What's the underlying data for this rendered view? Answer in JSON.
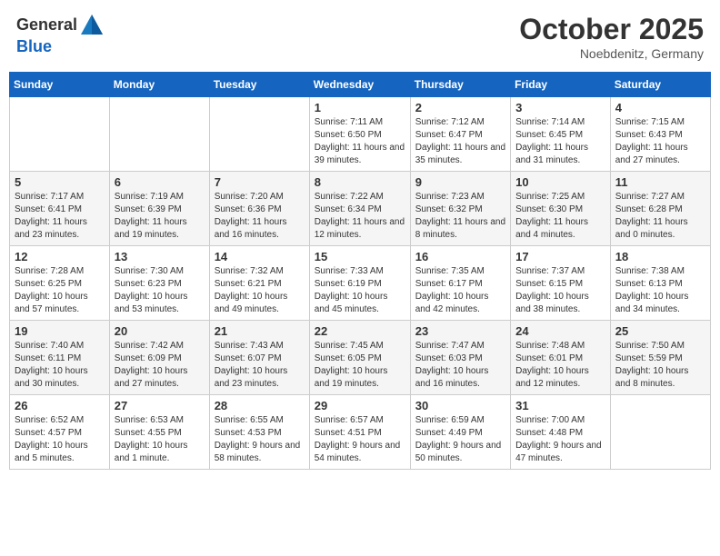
{
  "header": {
    "logo_line1": "General",
    "logo_line2": "Blue",
    "month": "October 2025",
    "location": "Noebdenitz, Germany"
  },
  "weekdays": [
    "Sunday",
    "Monday",
    "Tuesday",
    "Wednesday",
    "Thursday",
    "Friday",
    "Saturday"
  ],
  "weeks": [
    [
      {
        "day": "",
        "info": ""
      },
      {
        "day": "",
        "info": ""
      },
      {
        "day": "",
        "info": ""
      },
      {
        "day": "1",
        "info": "Sunrise: 7:11 AM\nSunset: 6:50 PM\nDaylight: 11 hours and 39 minutes."
      },
      {
        "day": "2",
        "info": "Sunrise: 7:12 AM\nSunset: 6:47 PM\nDaylight: 11 hours and 35 minutes."
      },
      {
        "day": "3",
        "info": "Sunrise: 7:14 AM\nSunset: 6:45 PM\nDaylight: 11 hours and 31 minutes."
      },
      {
        "day": "4",
        "info": "Sunrise: 7:15 AM\nSunset: 6:43 PM\nDaylight: 11 hours and 27 minutes."
      }
    ],
    [
      {
        "day": "5",
        "info": "Sunrise: 7:17 AM\nSunset: 6:41 PM\nDaylight: 11 hours and 23 minutes."
      },
      {
        "day": "6",
        "info": "Sunrise: 7:19 AM\nSunset: 6:39 PM\nDaylight: 11 hours and 19 minutes."
      },
      {
        "day": "7",
        "info": "Sunrise: 7:20 AM\nSunset: 6:36 PM\nDaylight: 11 hours and 16 minutes."
      },
      {
        "day": "8",
        "info": "Sunrise: 7:22 AM\nSunset: 6:34 PM\nDaylight: 11 hours and 12 minutes."
      },
      {
        "day": "9",
        "info": "Sunrise: 7:23 AM\nSunset: 6:32 PM\nDaylight: 11 hours and 8 minutes."
      },
      {
        "day": "10",
        "info": "Sunrise: 7:25 AM\nSunset: 6:30 PM\nDaylight: 11 hours and 4 minutes."
      },
      {
        "day": "11",
        "info": "Sunrise: 7:27 AM\nSunset: 6:28 PM\nDaylight: 11 hours and 0 minutes."
      }
    ],
    [
      {
        "day": "12",
        "info": "Sunrise: 7:28 AM\nSunset: 6:25 PM\nDaylight: 10 hours and 57 minutes."
      },
      {
        "day": "13",
        "info": "Sunrise: 7:30 AM\nSunset: 6:23 PM\nDaylight: 10 hours and 53 minutes."
      },
      {
        "day": "14",
        "info": "Sunrise: 7:32 AM\nSunset: 6:21 PM\nDaylight: 10 hours and 49 minutes."
      },
      {
        "day": "15",
        "info": "Sunrise: 7:33 AM\nSunset: 6:19 PM\nDaylight: 10 hours and 45 minutes."
      },
      {
        "day": "16",
        "info": "Sunrise: 7:35 AM\nSunset: 6:17 PM\nDaylight: 10 hours and 42 minutes."
      },
      {
        "day": "17",
        "info": "Sunrise: 7:37 AM\nSunset: 6:15 PM\nDaylight: 10 hours and 38 minutes."
      },
      {
        "day": "18",
        "info": "Sunrise: 7:38 AM\nSunset: 6:13 PM\nDaylight: 10 hours and 34 minutes."
      }
    ],
    [
      {
        "day": "19",
        "info": "Sunrise: 7:40 AM\nSunset: 6:11 PM\nDaylight: 10 hours and 30 minutes."
      },
      {
        "day": "20",
        "info": "Sunrise: 7:42 AM\nSunset: 6:09 PM\nDaylight: 10 hours and 27 minutes."
      },
      {
        "day": "21",
        "info": "Sunrise: 7:43 AM\nSunset: 6:07 PM\nDaylight: 10 hours and 23 minutes."
      },
      {
        "day": "22",
        "info": "Sunrise: 7:45 AM\nSunset: 6:05 PM\nDaylight: 10 hours and 19 minutes."
      },
      {
        "day": "23",
        "info": "Sunrise: 7:47 AM\nSunset: 6:03 PM\nDaylight: 10 hours and 16 minutes."
      },
      {
        "day": "24",
        "info": "Sunrise: 7:48 AM\nSunset: 6:01 PM\nDaylight: 10 hours and 12 minutes."
      },
      {
        "day": "25",
        "info": "Sunrise: 7:50 AM\nSunset: 5:59 PM\nDaylight: 10 hours and 8 minutes."
      }
    ],
    [
      {
        "day": "26",
        "info": "Sunrise: 6:52 AM\nSunset: 4:57 PM\nDaylight: 10 hours and 5 minutes."
      },
      {
        "day": "27",
        "info": "Sunrise: 6:53 AM\nSunset: 4:55 PM\nDaylight: 10 hours and 1 minute."
      },
      {
        "day": "28",
        "info": "Sunrise: 6:55 AM\nSunset: 4:53 PM\nDaylight: 9 hours and 58 minutes."
      },
      {
        "day": "29",
        "info": "Sunrise: 6:57 AM\nSunset: 4:51 PM\nDaylight: 9 hours and 54 minutes."
      },
      {
        "day": "30",
        "info": "Sunrise: 6:59 AM\nSunset: 4:49 PM\nDaylight: 9 hours and 50 minutes."
      },
      {
        "day": "31",
        "info": "Sunrise: 7:00 AM\nSunset: 4:48 PM\nDaylight: 9 hours and 47 minutes."
      },
      {
        "day": "",
        "info": ""
      }
    ]
  ]
}
